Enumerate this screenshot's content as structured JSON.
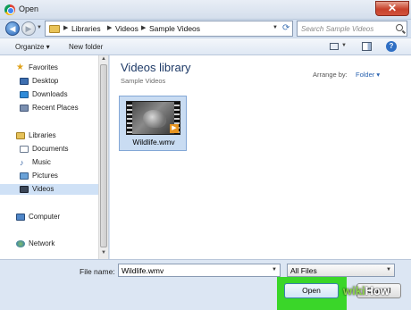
{
  "window": {
    "title": "Open",
    "close_glyph": "✕"
  },
  "nav": {
    "back_glyph": "◀",
    "forward_glyph": "▶",
    "breadcrumb": [
      "Libraries",
      "Videos",
      "Sample Videos"
    ],
    "search_placeholder": "Search Sample Videos"
  },
  "toolbar": {
    "organize_label": "Organize ▾",
    "new_folder_label": "New folder",
    "help_glyph": "?"
  },
  "sidebar": {
    "items": [
      {
        "label": "Favorites",
        "icon": "star-icon"
      },
      {
        "label": "Desktop",
        "icon": "desktop-icon"
      },
      {
        "label": "Downloads",
        "icon": "downloads-icon"
      },
      {
        "label": "Recent Places",
        "icon": "recent-places-icon"
      },
      {
        "label": "Libraries",
        "icon": "library-icon"
      },
      {
        "label": "Documents",
        "icon": "documents-icon"
      },
      {
        "label": "Music",
        "icon": "music-icon"
      },
      {
        "label": "Pictures",
        "icon": "pictures-icon"
      },
      {
        "label": "Videos",
        "icon": "videos-icon",
        "selected": true
      },
      {
        "label": "Computer",
        "icon": "computer-icon"
      },
      {
        "label": "Network",
        "icon": "network-icon"
      }
    ]
  },
  "content": {
    "library_title": "Videos library",
    "library_subtitle": "Sample Videos",
    "arrange_label": "Arrange by:",
    "arrange_value": "Folder ▾",
    "files": [
      {
        "name": "Wildlife.wmv",
        "selected": true
      }
    ]
  },
  "footer": {
    "file_name_label": "File name:",
    "file_name_value": "Wildlife.wmv",
    "file_type_value": "All Files",
    "open_label": "Open",
    "cancel_label": "Cancel"
  },
  "watermark": {
    "part1": "wiki",
    "part2": "How"
  },
  "colors": {
    "accent": "#3ad629",
    "selection": "#c9dcf2",
    "close": "#c7412b"
  }
}
